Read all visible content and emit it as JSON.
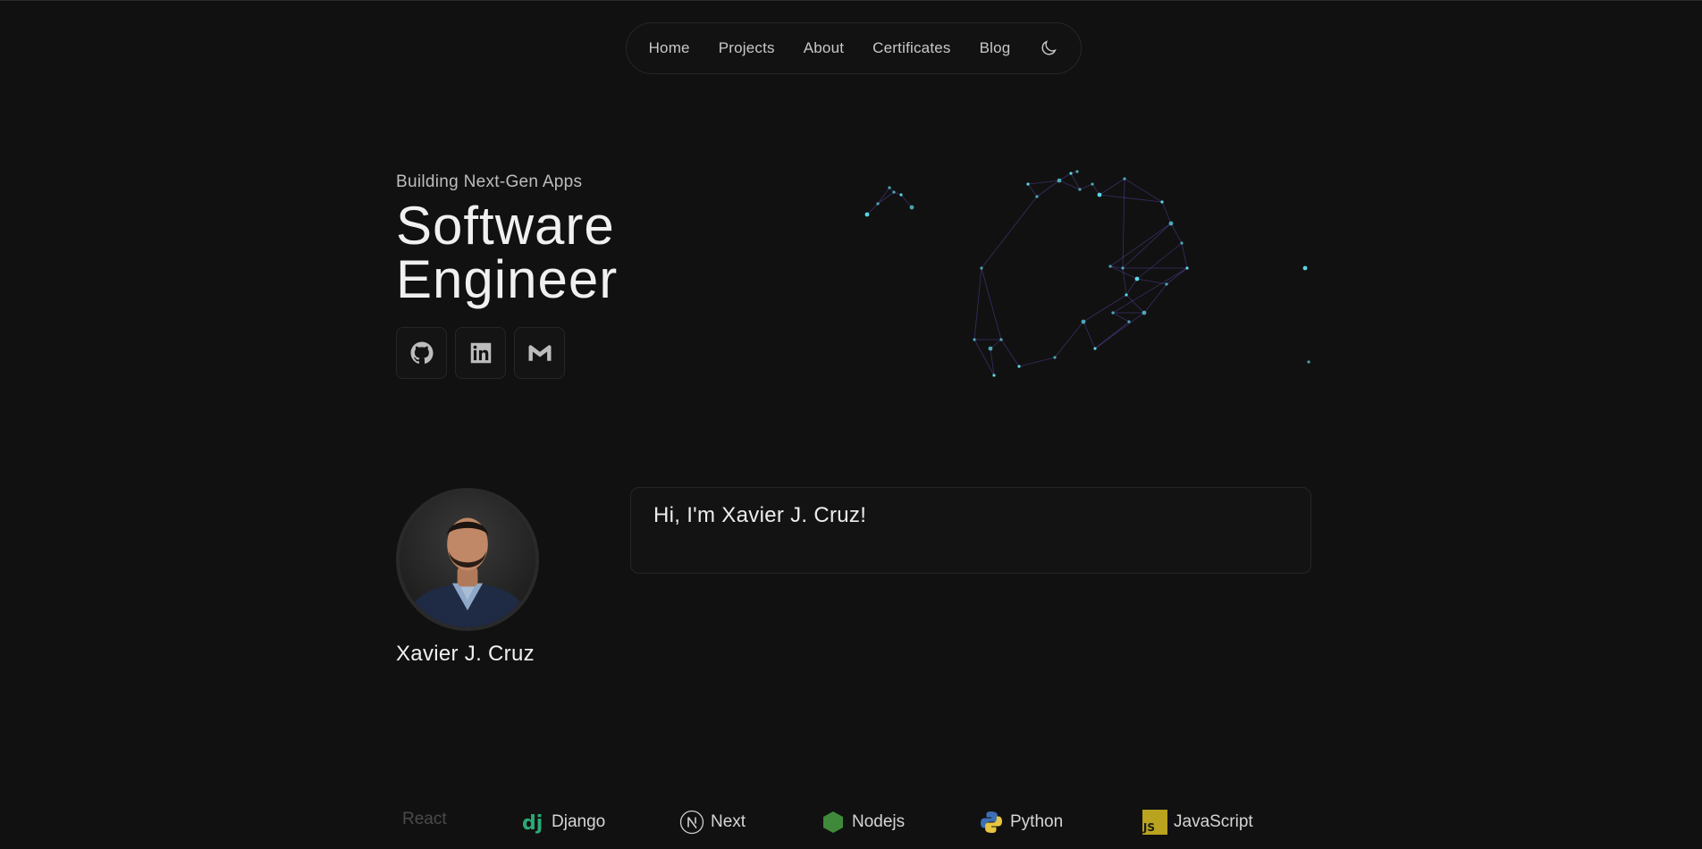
{
  "nav": {
    "items": [
      {
        "label": "Home"
      },
      {
        "label": "Projects"
      },
      {
        "label": "About"
      },
      {
        "label": "Certificates"
      },
      {
        "label": "Blog"
      }
    ],
    "theme_toggle_icon": "moon-icon"
  },
  "hero": {
    "eyebrow": "Building Next-Gen Apps",
    "title_line1": "Software",
    "title_line2": "Engineer",
    "socials": [
      {
        "icon": "github-icon"
      },
      {
        "icon": "linkedin-icon"
      },
      {
        "icon": "gmail-icon"
      }
    ]
  },
  "about": {
    "name": "Xavier J. Cruz",
    "greeting": "Hi, I'm Xavier J. Cruz!",
    "avatar_icon": "profile-photo"
  },
  "tech": [
    {
      "label": "React",
      "icon": "react-icon"
    },
    {
      "label": "Django",
      "icon": "django-icon"
    },
    {
      "label": "Next",
      "icon": "nextjs-icon"
    },
    {
      "label": "Nodejs",
      "icon": "nodejs-icon"
    },
    {
      "label": "Python",
      "icon": "python-icon"
    },
    {
      "label": "JavaScript",
      "icon": "javascript-icon"
    }
  ],
  "colors": {
    "background": "#111111",
    "node": "#5fe3f0",
    "edge": "#6b4fc8",
    "django": "#2ba977",
    "nodejs": "#3f8a3a",
    "javascript": "#c9b21e"
  }
}
